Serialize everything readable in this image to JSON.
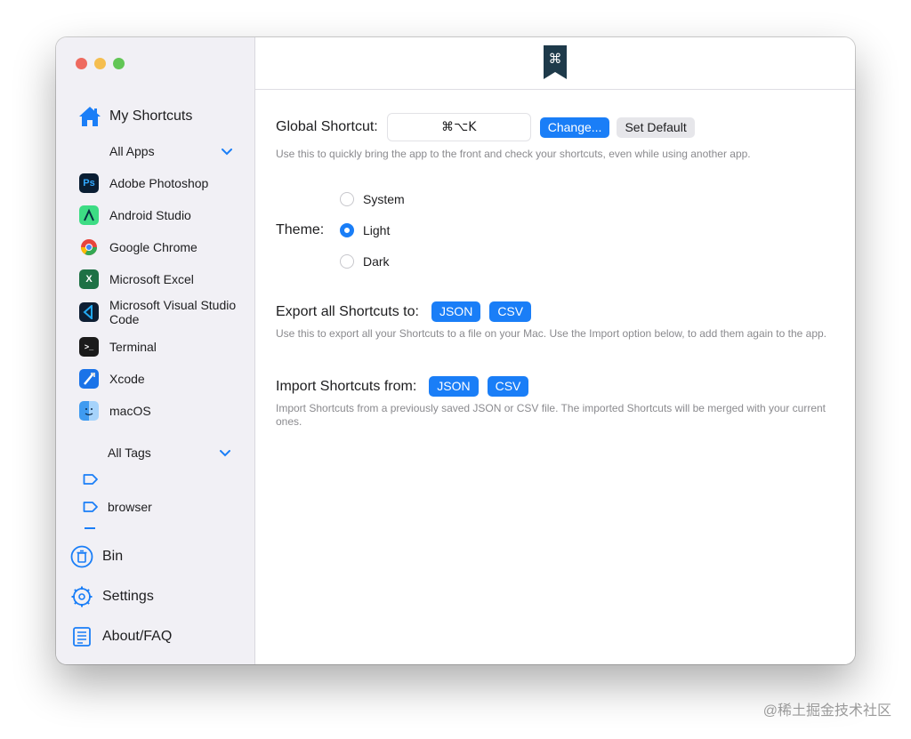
{
  "sidebar": {
    "main_label": "My Shortcuts",
    "apps_header": "All Apps",
    "apps": [
      {
        "label": "Adobe Photoshop",
        "icon": "photoshop-icon",
        "glyph": "Ps",
        "color": "#0a1e33"
      },
      {
        "label": "Android Studio",
        "icon": "android-studio-icon",
        "glyph": "",
        "color": "#3ddc84"
      },
      {
        "label": "Google Chrome",
        "icon": "chrome-icon",
        "glyph": "",
        "color": "#e8453c"
      },
      {
        "label": "Microsoft Excel",
        "icon": "excel-icon",
        "glyph": "X",
        "color": "#1e7145"
      },
      {
        "label": "Microsoft Visual Studio Code",
        "icon": "vscode-icon",
        "glyph": "",
        "color": "#0e1e33"
      },
      {
        "label": "Terminal",
        "icon": "terminal-icon",
        "glyph": ">_",
        "color": "#1b1b1b"
      },
      {
        "label": "Xcode",
        "icon": "xcode-icon",
        "glyph": "",
        "color": "#1b73e8"
      },
      {
        "label": "macOS",
        "icon": "finder-icon",
        "glyph": "",
        "color": "#3f9bf0"
      }
    ],
    "tags_header": "All Tags",
    "tags": [
      "",
      "browser"
    ],
    "bin_label": "Bin",
    "settings_label": "Settings",
    "about_label": "About/FAQ"
  },
  "settings": {
    "global_shortcut_label": "Global Shortcut:",
    "global_shortcut_value": "⌘⌥K",
    "change_button": "Change...",
    "set_default_button": "Set Default",
    "global_help": "Use this to quickly bring the app to the front and check your shortcuts, even while using another app.",
    "theme_label": "Theme:",
    "theme_options": [
      "System",
      "Light",
      "Dark"
    ],
    "theme_selected": "Light",
    "export_label": "Export all Shortcuts to:",
    "export_json": "JSON",
    "export_csv": "CSV",
    "export_help": "Use this to export all your Shortcuts to a file on your Mac. Use the Import option below, to add them again to the app.",
    "import_label": "Import Shortcuts from:",
    "import_json": "JSON",
    "import_csv": "CSV",
    "import_help": "Import Shortcuts from a previously saved JSON or CSV file. The imported Shortcuts will be merged with your current ones."
  },
  "toolbar": {
    "icon": "command-bookmark-icon",
    "glyph": "⌘"
  },
  "colors": {
    "accent": "#1a7ef7",
    "sidebar_bg": "#f1f0f5"
  },
  "watermark": "@稀土掘金技术社区"
}
